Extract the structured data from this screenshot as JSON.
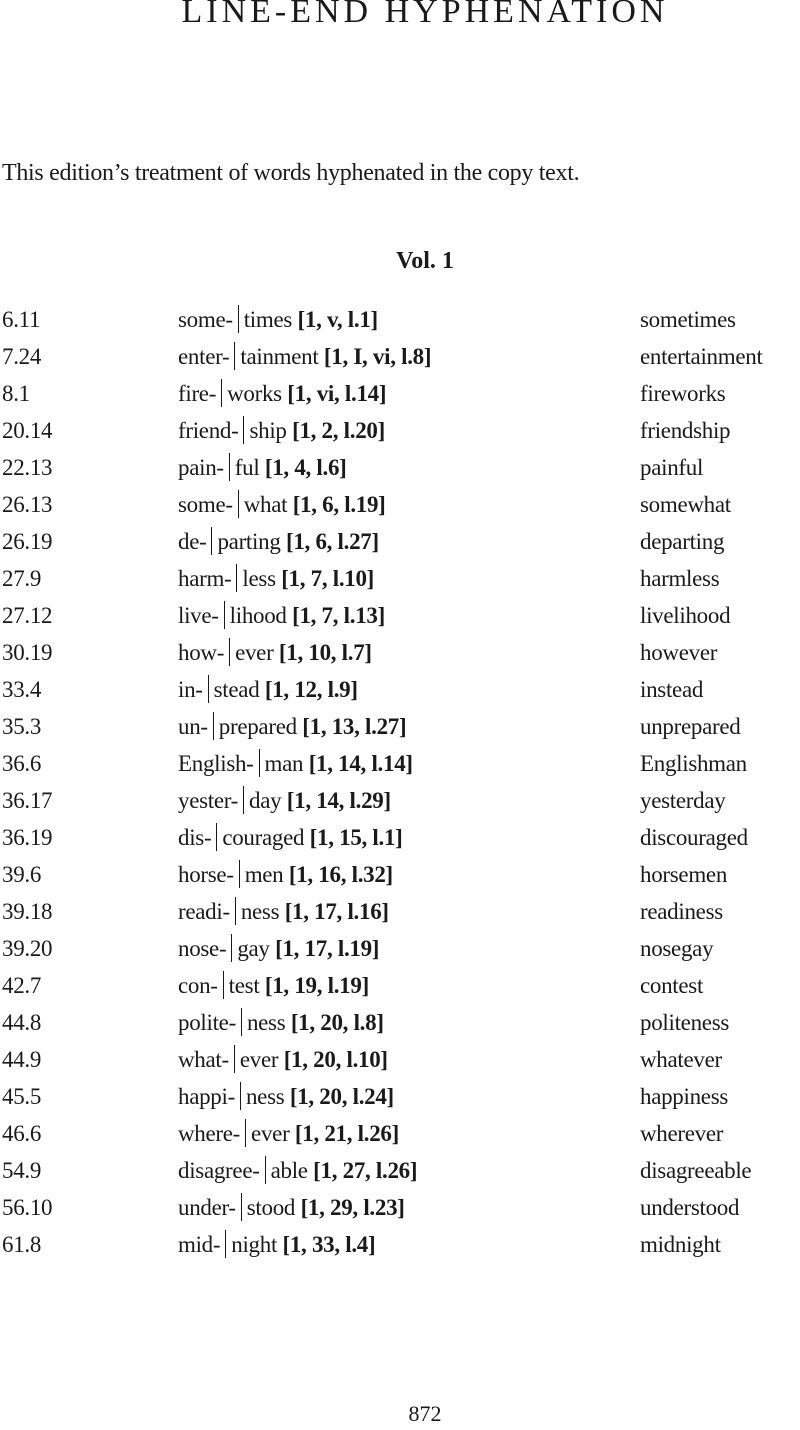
{
  "running_head": "LINE-END HYPHENATION",
  "intro": "This edition’s treatment of words hyphenated in the copy text.",
  "volume_heading": "Vol. 1",
  "entries": [
    {
      "ref": "6.11",
      "first": "some-",
      "second": "times",
      "loc": "[1, v, l.1]",
      "reading": "sometimes"
    },
    {
      "ref": "7.24",
      "first": "enter-",
      "second": "tainment",
      "loc": "[1, I, vi, l.8]",
      "reading": "entertainment"
    },
    {
      "ref": "8.1",
      "first": "fire-",
      "second": "works",
      "loc": "[1, vi, l.14]",
      "reading": "fireworks"
    },
    {
      "ref": "20.14",
      "first": "friend-",
      "second": "ship",
      "loc": "[1, 2, l.20]",
      "reading": "friendship"
    },
    {
      "ref": "22.13",
      "first": "pain-",
      "second": "ful",
      "loc": "[1, 4, l.6]",
      "reading": "painful"
    },
    {
      "ref": "26.13",
      "first": "some-",
      "second": "what",
      "loc": "[1, 6, l.19]",
      "reading": "somewhat"
    },
    {
      "ref": "26.19",
      "first": "de-",
      "second": "parting",
      "loc": "[1, 6, l.27]",
      "reading": "departing"
    },
    {
      "ref": "27.9",
      "first": "harm-",
      "second": "less",
      "loc": "[1, 7, l.10]",
      "reading": "harmless"
    },
    {
      "ref": "27.12",
      "first": "live-",
      "second": "lihood",
      "loc": "[1, 7, l.13]",
      "reading": "livelihood"
    },
    {
      "ref": "30.19",
      "first": "how-",
      "second": "ever",
      "loc": "[1, 10, l.7]",
      "reading": "however"
    },
    {
      "ref": "33.4",
      "first": "in-",
      "second": "stead",
      "loc": "[1, 12, l.9]",
      "reading": "instead"
    },
    {
      "ref": "35.3",
      "first": "un-",
      "second": "prepared",
      "loc": "[1, 13, l.27]",
      "reading": "unprepared"
    },
    {
      "ref": "36.6",
      "first": "English-",
      "second": "man",
      "loc": "[1, 14, l.14]",
      "reading": "Englishman"
    },
    {
      "ref": "36.17",
      "first": "yester-",
      "second": "day",
      "loc": "[1, 14, l.29]",
      "reading": "yesterday"
    },
    {
      "ref": "36.19",
      "first": "dis-",
      "second": "couraged",
      "loc": "[1, 15, l.1]",
      "reading": "discouraged"
    },
    {
      "ref": "39.6",
      "first": "horse-",
      "second": "men",
      "loc": "[1, 16, l.32]",
      "reading": "horsemen"
    },
    {
      "ref": "39.18",
      "first": "readi-",
      "second": "ness",
      "loc": "[1, 17, l.16]",
      "reading": "readiness"
    },
    {
      "ref": "39.20",
      "first": "nose-",
      "second": "gay",
      "loc": "[1, 17, l.19]",
      "reading": "nosegay"
    },
    {
      "ref": "42.7",
      "first": "con-",
      "second": "test",
      "loc": "[1, 19, l.19]",
      "reading": "contest"
    },
    {
      "ref": "44.8",
      "first": "polite-",
      "second": "ness",
      "loc": "[1, 20, l.8]",
      "reading": "politeness"
    },
    {
      "ref": "44.9",
      "first": "what-",
      "second": "ever",
      "loc": "[1, 20, l.10]",
      "reading": "whatever"
    },
    {
      "ref": "45.5",
      "first": "happi-",
      "second": "ness",
      "loc": "[1, 20, l.24]",
      "reading": "happiness"
    },
    {
      "ref": "46.6",
      "first": "where-",
      "second": "ever",
      "loc": "[1, 21, l.26]",
      "reading": "wherever"
    },
    {
      "ref": "54.9",
      "first": "disagree-",
      "second": "able",
      "loc": "[1, 27, l.26]",
      "reading": "disagreeable"
    },
    {
      "ref": "56.10",
      "first": "under-",
      "second": "stood",
      "loc": "[1, 29, l.23]",
      "reading": "understood"
    },
    {
      "ref": "61.8",
      "first": "mid-",
      "second": "night",
      "loc": "[1, 33, l.4]",
      "reading": "midnight"
    }
  ],
  "page_number": "872"
}
